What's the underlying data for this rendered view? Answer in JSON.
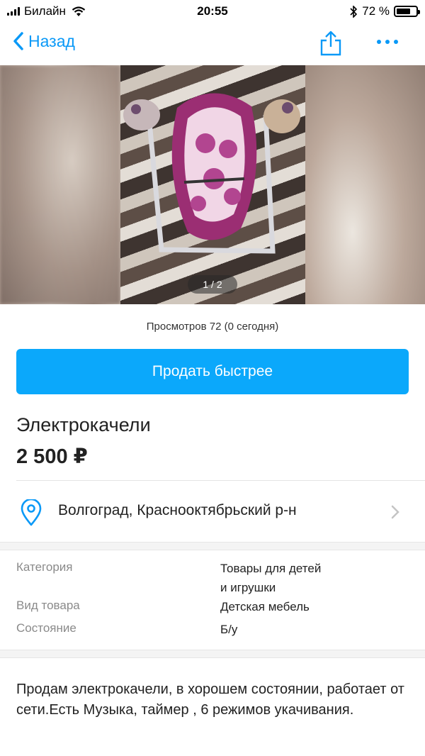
{
  "status_bar": {
    "carrier": "Билайн",
    "time": "20:55",
    "battery_percent": "72 %",
    "battery_level": 0.72
  },
  "nav": {
    "back_label": "Назад",
    "icons": [
      "chevron-left-icon",
      "share-icon",
      "more-icon"
    ],
    "accent_color": "#0a99f7"
  },
  "gallery": {
    "counter": "1 / 2"
  },
  "views_text": "Просмотров 72 (0 сегодня)",
  "sell_button_label": "Продать быстрее",
  "sell_button_color": "#0ba8fb",
  "listing": {
    "title": "Электрокачели",
    "price": "2 500 ₽"
  },
  "location": {
    "text": "Волгоград, Краснооктябрьский р-н"
  },
  "params": [
    {
      "label": "Категория",
      "value_line1": "Товары для детей",
      "value_line2": "и игрушки"
    },
    {
      "label": "Вид товара",
      "value_line1": "Детская мебель"
    },
    {
      "label": "Состояние",
      "value_line1": "Б/у"
    }
  ],
  "description": "Продам электрокачели, в хорошем состоянии, работает от сети.Есть Музыка, таймер , 6 режимов укачивания."
}
